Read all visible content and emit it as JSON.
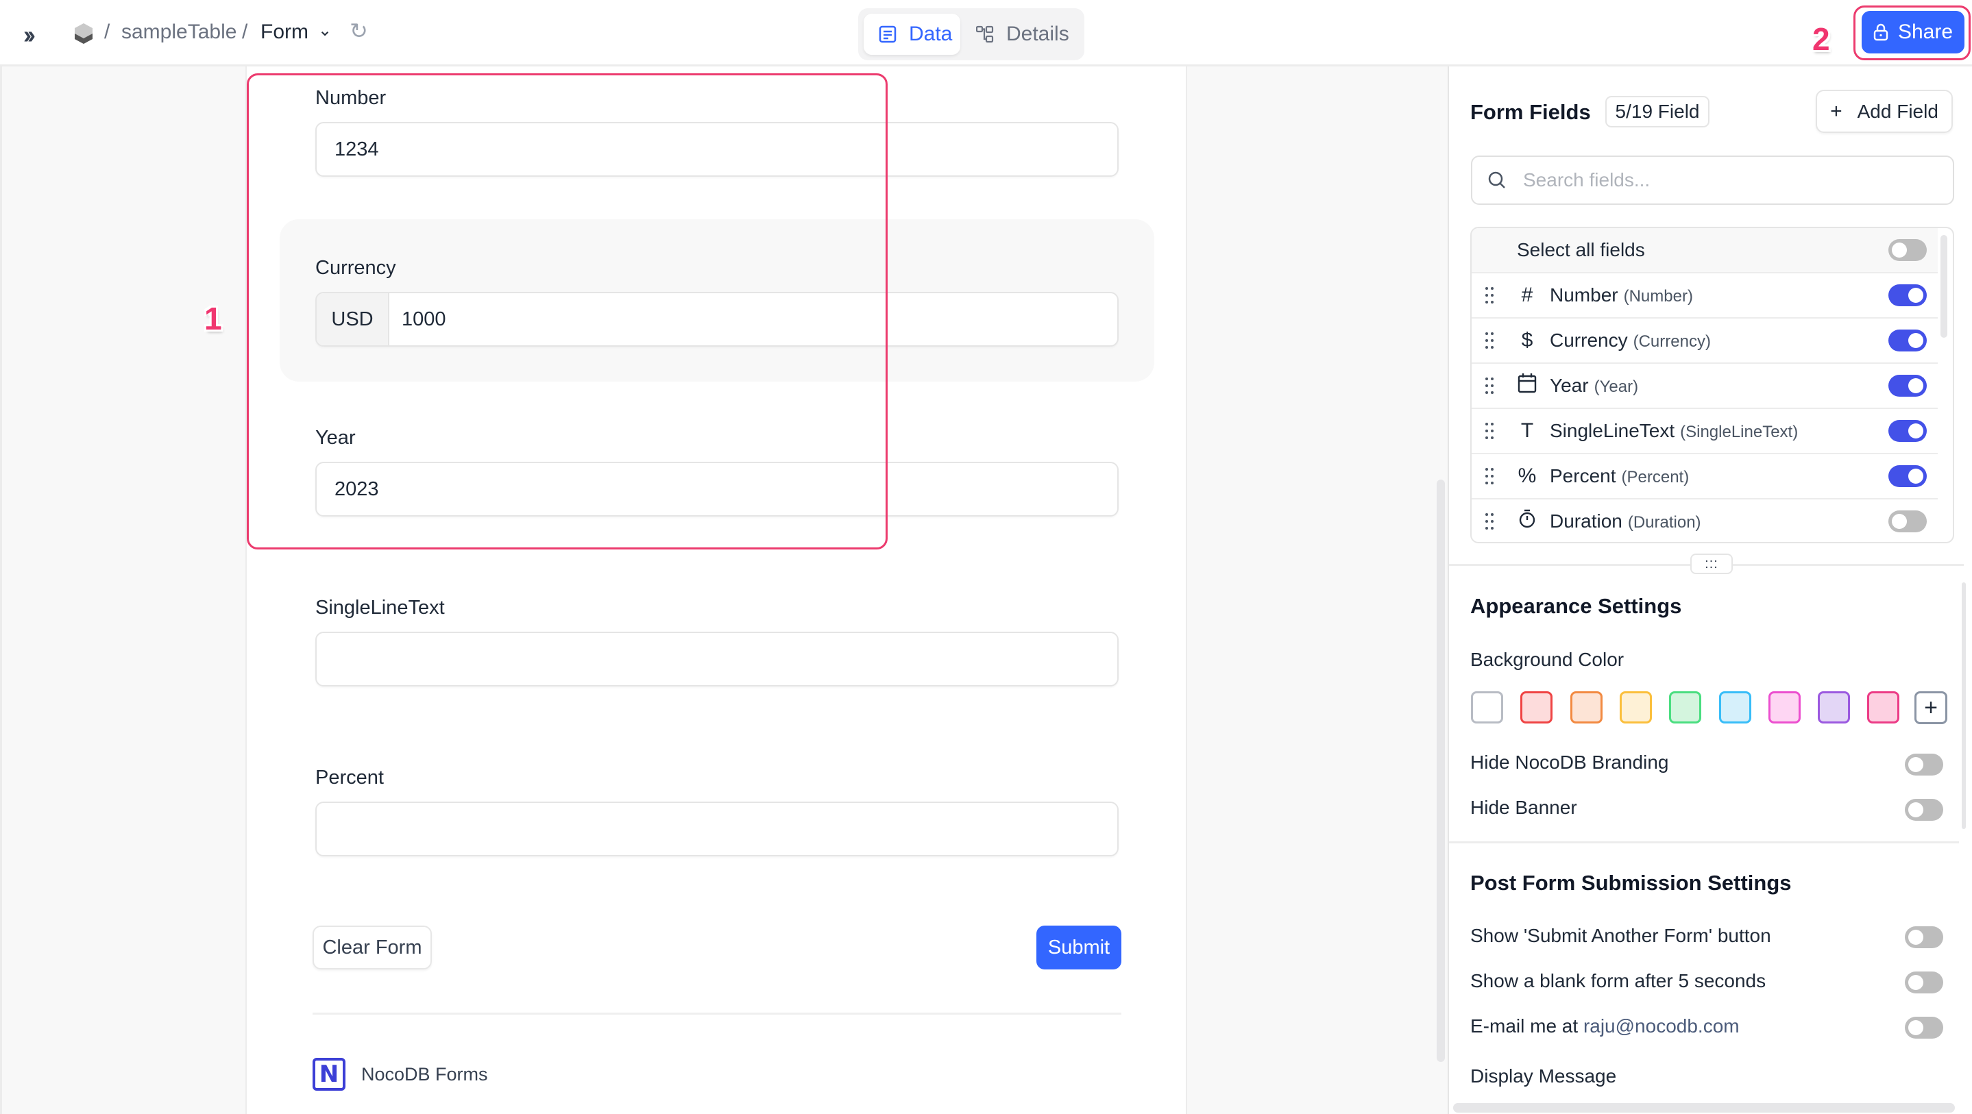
{
  "topbar": {
    "expand_icon": "double-chevron-right",
    "breadcrumb": {
      "sep": "/",
      "table": "sampleTable",
      "view": "Form"
    },
    "tabs": [
      {
        "label": "Data",
        "icon": "grid-icon",
        "active": true
      },
      {
        "label": "Details",
        "icon": "schema-icon",
        "active": false
      }
    ],
    "share_label": "Share"
  },
  "annotations": {
    "one": "1",
    "two": "2",
    "color": "#ec3b6e"
  },
  "form": {
    "fields": [
      {
        "label": "Number",
        "value": "1234"
      },
      {
        "label": "Currency",
        "prefix": "USD",
        "value": "1000"
      },
      {
        "label": "Year",
        "value": "2023"
      },
      {
        "label": "SingleLineText",
        "value": ""
      },
      {
        "label": "Percent",
        "value": ""
      }
    ],
    "clear_label": "Clear Form",
    "submit_label": "Submit",
    "branding_logo": "N",
    "branding_text": "NocoDB Forms"
  },
  "panel": {
    "title": "Form Fields",
    "count": "5/19 Field",
    "add_field_label": "Add Field",
    "search_placeholder": "Search fields...",
    "select_all_label": "Select all fields",
    "select_all_on": false,
    "fields": [
      {
        "name": "Number",
        "type": "(Number)",
        "icon": "#",
        "on": true
      },
      {
        "name": "Currency",
        "type": "(Currency)",
        "icon": "$",
        "on": true
      },
      {
        "name": "Year",
        "type": "(Year)",
        "icon": "calendar",
        "on": true
      },
      {
        "name": "SingleLineText",
        "type": "(SingleLineText)",
        "icon": "T",
        "on": true
      },
      {
        "name": "Percent",
        "type": "(Percent)",
        "icon": "%",
        "on": true
      },
      {
        "name": "Duration",
        "type": "(Duration)",
        "icon": "stopwatch",
        "on": false
      }
    ],
    "resize_handle": ":::",
    "appearance": {
      "title": "Appearance Settings",
      "bg_color_label": "Background Color",
      "swatches": [
        {
          "fill": "#ffffff",
          "border": "#b8bcc4"
        },
        {
          "fill": "#fddcdc",
          "border": "#ef4444"
        },
        {
          "fill": "#fde4d6",
          "border": "#f28a42"
        },
        {
          "fill": "#fef1d6",
          "border": "#fbbf3c"
        },
        {
          "fill": "#d4f5de",
          "border": "#4ade80"
        },
        {
          "fill": "#d6f0fb",
          "border": "#38bdf8"
        },
        {
          "fill": "#fed6f3",
          "border": "#ec4fcf"
        },
        {
          "fill": "#e3d6f6",
          "border": "#9b59e0"
        },
        {
          "fill": "#fdd0e1",
          "border": "#ec3b86"
        }
      ],
      "add_swatch": "+",
      "hide_branding_label": "Hide NocoDB Branding",
      "hide_branding_on": false,
      "hide_banner_label": "Hide Banner",
      "hide_banner_on": false
    },
    "post_submit": {
      "title": "Post Form Submission Settings",
      "submit_another_label": "Show 'Submit Another Form' button",
      "submit_another_on": false,
      "blank_form_label": "Show a blank form after 5 seconds",
      "blank_form_on": false,
      "email_label": "E-mail me at ",
      "email_value": "raju@nocodb.com",
      "email_on": false,
      "display_message_label": "Display Message"
    }
  }
}
